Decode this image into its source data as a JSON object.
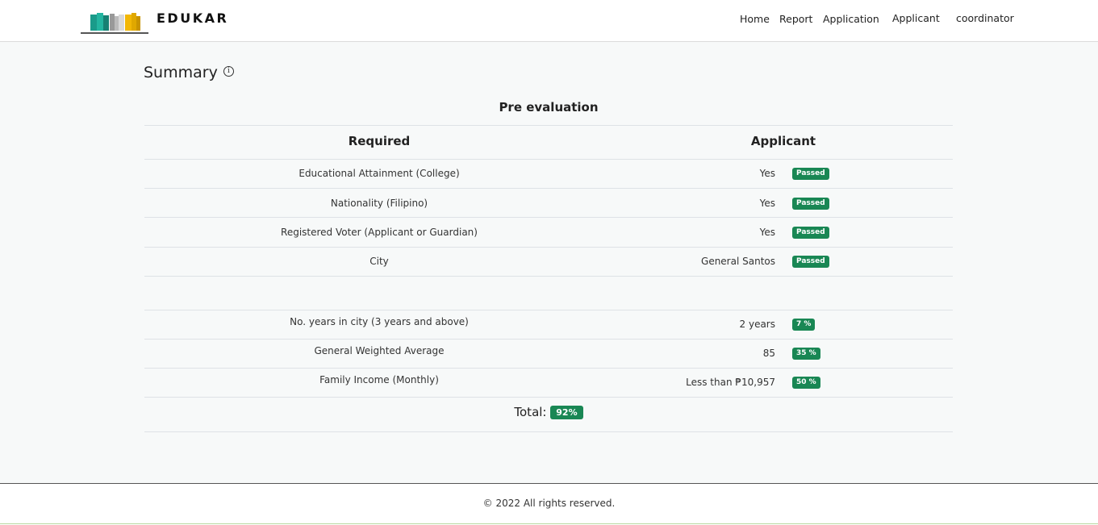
{
  "brand": {
    "name": "EDUKAR"
  },
  "nav": {
    "home": "Home",
    "report": "Report",
    "application": "Application",
    "applicant": "Applicant",
    "user": "coordinator"
  },
  "page": {
    "title": "Summary",
    "info_icon": "info-icon",
    "section_title": "Pre evaluation"
  },
  "table": {
    "headers": {
      "required": "Required",
      "applicant": "Applicant"
    },
    "requirements": [
      {
        "label": "Educational Attainment (College)",
        "value": "Yes",
        "badge": "Passed"
      },
      {
        "label": "Nationality (Filipino)",
        "value": "Yes",
        "badge": "Passed"
      },
      {
        "label": "Registered Voter (Applicant or Guardian)",
        "value": "Yes",
        "badge": "Passed"
      },
      {
        "label": "City",
        "value": "General Santos",
        "badge": "Passed"
      }
    ],
    "criteria": [
      {
        "label": "No. years in city (3 years and above)",
        "value": "2 years",
        "badge": "7 %"
      },
      {
        "label": "General Weighted Average",
        "value": "85",
        "badge": "35 %"
      },
      {
        "label": "Family Income (Monthly)",
        "value": "Less than ₱10,957",
        "badge": "50 %"
      }
    ],
    "total_label": "Total:",
    "total_value": "92%"
  },
  "footer": {
    "text": "© 2022 All rights reserved."
  },
  "colors": {
    "badge": "#198754",
    "background": "#f7f9f9"
  }
}
